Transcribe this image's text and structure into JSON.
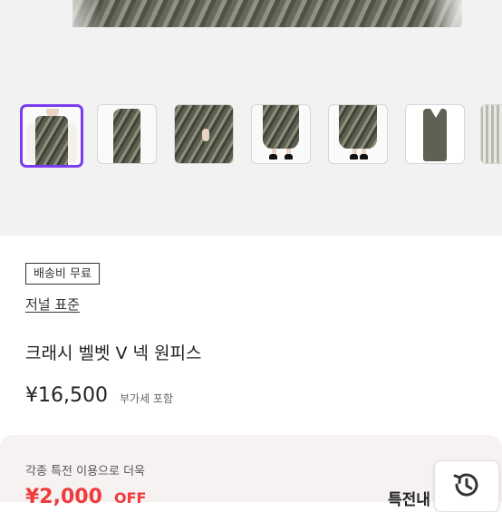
{
  "gallery": {
    "thumbnails": [
      {
        "name": "thumb-front-view",
        "selected": true
      },
      {
        "name": "thumb-side-view",
        "selected": false
      },
      {
        "name": "thumb-pocket-detail",
        "selected": false
      },
      {
        "name": "thumb-full-length-heels",
        "selected": false
      },
      {
        "name": "thumb-full-length-side",
        "selected": false
      },
      {
        "name": "thumb-flat-lay",
        "selected": false
      },
      {
        "name": "thumb-fabric-detail",
        "selected": false
      }
    ]
  },
  "product": {
    "shipping_badge": "배송비 무료",
    "brand": "저널 표준",
    "title": "크래시 벨벳 V 넥 원피스",
    "price": "¥16,500",
    "vat_note": "부가세 포함"
  },
  "benefit": {
    "label": "각종 특전 이용으로 더욱",
    "discount": "¥2,000",
    "off": "OFF",
    "special_link": "특전내"
  },
  "colors": {
    "accent_selected": "#7a3cf0",
    "discount_red": "#ef3b3b",
    "benefit_bg": "#f7f2f2"
  },
  "icons": {
    "recent_view": "history-clock-icon"
  }
}
